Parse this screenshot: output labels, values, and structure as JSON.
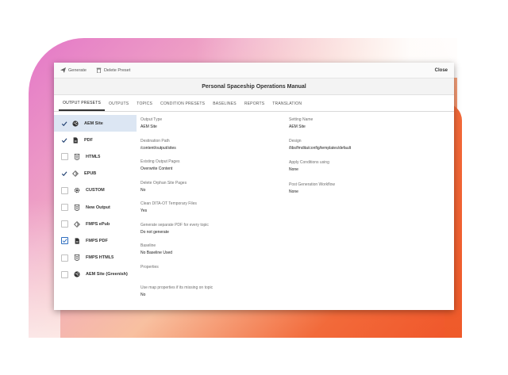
{
  "toolbar": {
    "generate_label": "Generate",
    "delete_label": "Delete Preset",
    "close_label": "Close"
  },
  "title": "Personal Spaceship Operations Manual",
  "tabs": [
    "OUTPUT PRESETS",
    "OUTPUTS",
    "TOPICS",
    "CONDITION PRESETS",
    "BASELINES",
    "REPORTS",
    "TRANSLATION"
  ],
  "presets": [
    {
      "label": "AEM Site",
      "icon": "globe-icon",
      "checked": true,
      "selected": true
    },
    {
      "label": "PDF",
      "icon": "pdf-file-icon",
      "checked": true,
      "selected": false
    },
    {
      "label": "HTML5",
      "icon": "html5-icon",
      "checked": false,
      "selected": false
    },
    {
      "label": "EPUB",
      "icon": "epub-icon",
      "checked": true,
      "selected": false
    },
    {
      "label": "CUSTOM",
      "icon": "gear-icon",
      "checked": false,
      "selected": false
    },
    {
      "label": "New Output",
      "icon": "html5-icon",
      "checked": false,
      "selected": false
    },
    {
      "label": "FMPS ePub",
      "icon": "epub-icon",
      "checked": false,
      "selected": false
    },
    {
      "label": "FMPS PDF",
      "icon": "pdf-file-icon",
      "checked": true,
      "selected": false,
      "boxed": true
    },
    {
      "label": "FMPS HTML5",
      "icon": "html5-icon",
      "checked": false,
      "selected": false
    },
    {
      "label": "AEM Site (Greenish)",
      "icon": "globe-icon",
      "checked": false,
      "selected": false
    }
  ],
  "fields_left": [
    {
      "label": "Output Type",
      "value": "AEM Site"
    },
    {
      "label": "Destination Path",
      "value": "/content/output/sites"
    },
    {
      "label": "Existing Output Pages",
      "value": "Overwrite Content"
    },
    {
      "label": "Delete Orphan Site Pages",
      "value": "No"
    },
    {
      "label": "Clean DITA-OT Temporary Files",
      "value": "Yes"
    },
    {
      "label": "Generate separate PDF for every topic",
      "value": "Do not generate"
    },
    {
      "label": "Baseline",
      "value": "No Baseline Used"
    },
    {
      "label": "Properties",
      "value": ""
    },
    {
      "label": "Use map properties if its missing on topic",
      "value": "No"
    }
  ],
  "fields_right": [
    {
      "label": "Setting Name",
      "value": "AEM Site"
    },
    {
      "label": "Design",
      "value": "/libs/fmdita/config/templates/default"
    },
    {
      "label": "Apply Conditions using",
      "value": "None"
    },
    {
      "label": "Post Generation Workflow",
      "value": "None"
    }
  ],
  "colors": {
    "accent": "#2f6fc0",
    "selected_row": "#dce6f3",
    "gradient_start": "#e478c8",
    "gradient_end": "#f0562a"
  }
}
